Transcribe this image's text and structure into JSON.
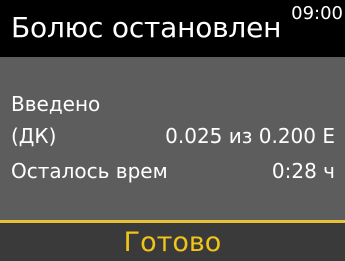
{
  "header": {
    "title": "Болюс остановлен",
    "time": "09:00"
  },
  "details": {
    "delivered_label_line1": "Введено",
    "delivered_label_line2": "(ДК)",
    "delivered_value": "0.025 из 0.200 Е",
    "remaining_label": "Осталось врем",
    "remaining_value": "0:28 ч"
  },
  "footer": {
    "done_label": "Готово"
  },
  "colors": {
    "background": "#5d5d5d",
    "header": "#000000",
    "accent": "#f0c419"
  }
}
